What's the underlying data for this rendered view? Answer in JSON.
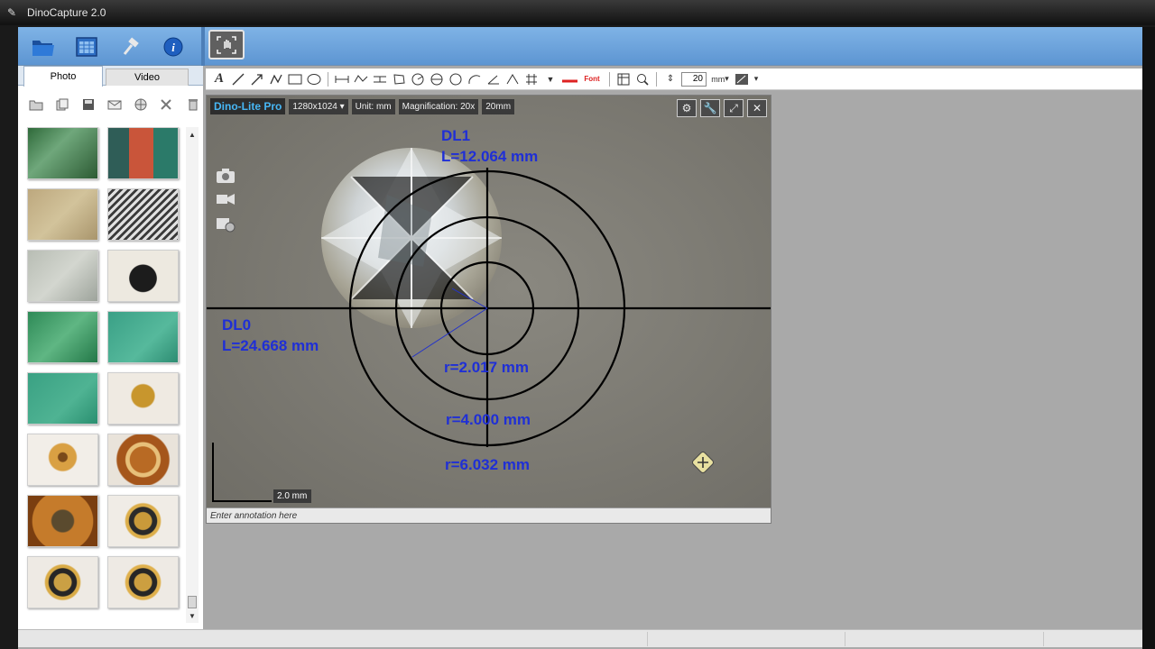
{
  "window": {
    "title": "DinoCapture 2.0"
  },
  "left_panel": {
    "tabs": [
      {
        "label": "Photo",
        "active": true
      },
      {
        "label": "Video",
        "active": false
      }
    ],
    "thumbnails": [
      {
        "name": "pcb-text"
      },
      {
        "name": "color-tiles"
      },
      {
        "name": "paper-fibers"
      },
      {
        "name": "striped-metal"
      },
      {
        "name": "insect-leg"
      },
      {
        "name": "dark-insect"
      },
      {
        "name": "green-pcb"
      },
      {
        "name": "green-pcb-trace"
      },
      {
        "name": "green-pcb-2"
      },
      {
        "name": "gold-connector"
      },
      {
        "name": "gold-ring-small"
      },
      {
        "name": "copper-ring"
      },
      {
        "name": "copper-disc"
      },
      {
        "name": "gold-gear-1"
      },
      {
        "name": "gold-gear-2"
      },
      {
        "name": "gold-gear-3"
      }
    ]
  },
  "anno_toolbar": {
    "zoom_value": "20",
    "unit_label": "mm"
  },
  "viewer": {
    "brand": "Dino-Lite Pro",
    "resolution": "1280x1024",
    "unit": "Unit: mm",
    "magnification_label": "Magnification:",
    "magnification_value": "20x",
    "scale": "20mm",
    "scale_bar_label": "2.0 mm",
    "annotation_placeholder": "Enter annotation here",
    "measurements": {
      "dl1_name": "DL1",
      "dl1_value": "L=12.064 mm",
      "dl0_name": "DL0",
      "dl0_value": "L=24.668 mm",
      "r1": "r=2.017 mm",
      "r2": "r=4.000 mm",
      "r3": "r=6.032 mm"
    }
  }
}
